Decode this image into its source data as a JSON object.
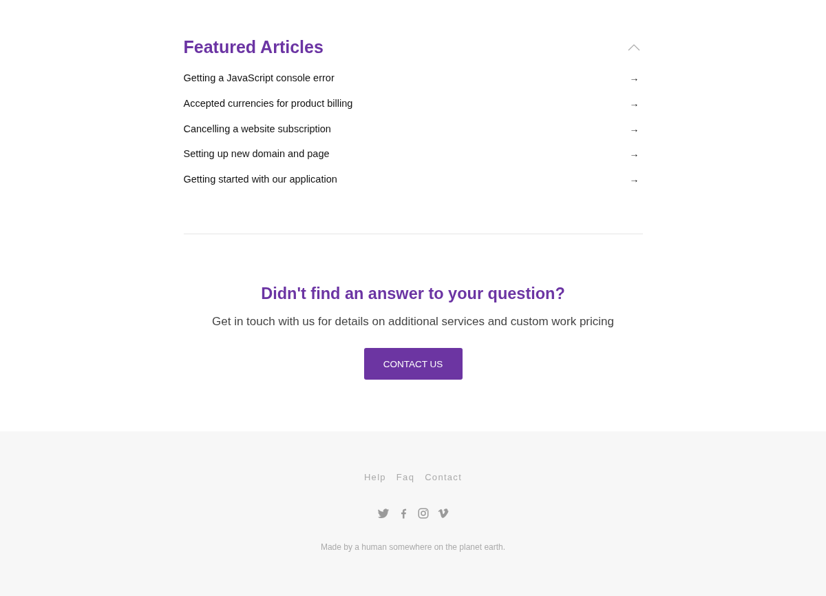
{
  "featured": {
    "title": "Featured Articles",
    "expanded": true,
    "articles": [
      {
        "title": "Getting a JavaScript console error",
        "arrow": "→"
      },
      {
        "title": "Accepted currencies for product billing",
        "arrow": "→"
      },
      {
        "title": "Cancelling a website subscription",
        "arrow": "→"
      },
      {
        "title": "Setting up new domain and page",
        "arrow": "→"
      },
      {
        "title": "Getting started with our application",
        "arrow": "→"
      }
    ]
  },
  "cta": {
    "heading": "Didn't find an answer to your question?",
    "text": "Get in touch with us for details on additional services and custom work pricing",
    "button": "CONTACT US"
  },
  "footer": {
    "links": [
      "Help",
      "Faq",
      "Contact"
    ],
    "social": [
      {
        "kind": "twitter"
      },
      {
        "kind": "facebook"
      },
      {
        "kind": "instagram"
      },
      {
        "kind": "vimeo"
      }
    ],
    "note": "Made by a human somewhere on the planet earth."
  }
}
